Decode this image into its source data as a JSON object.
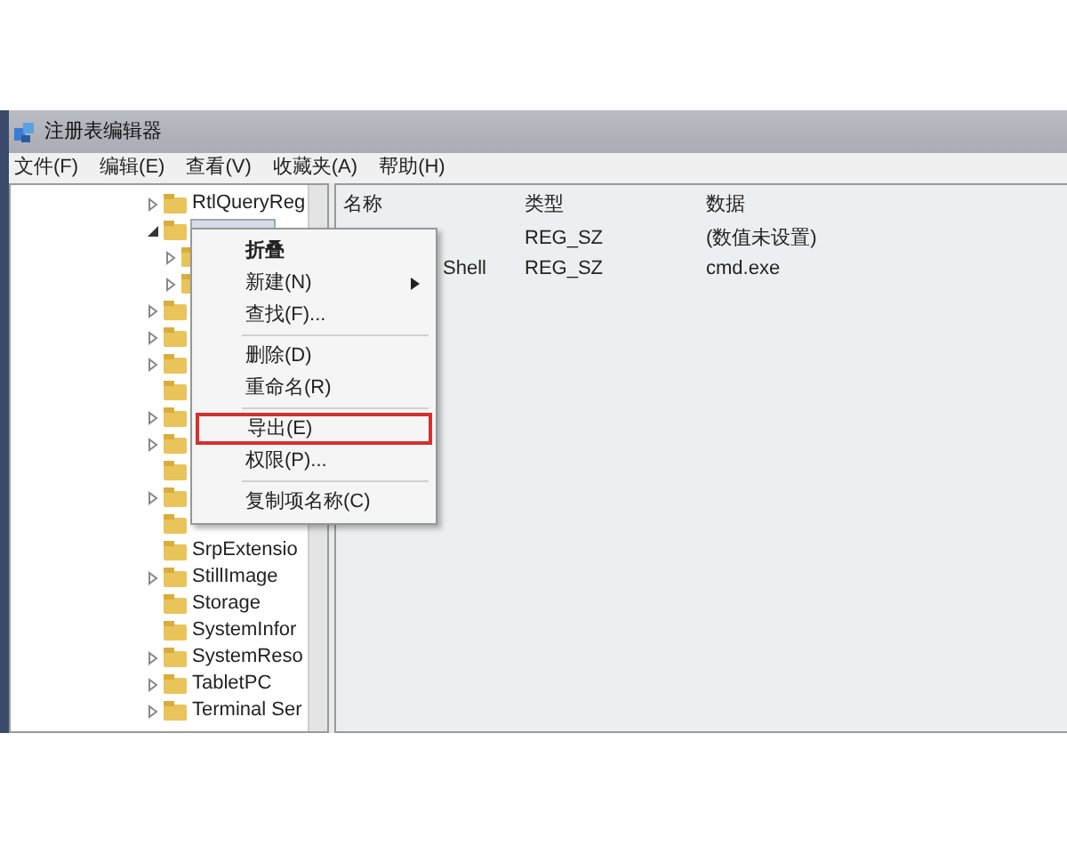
{
  "window": {
    "title": "注册表编辑器"
  },
  "menu_bar": [
    "文件(F)",
    "编辑(E)",
    "查看(V)",
    "收藏夹(A)",
    "帮助(H)"
  ],
  "tree": [
    {
      "label": "RtlQueryReg",
      "expandable": true,
      "expanded": false,
      "selected": false
    },
    {
      "expandable": true,
      "expanded": true,
      "selected": true,
      "children": [
        {
          "expandable": true
        },
        {
          "expandable": true
        }
      ]
    },
    {
      "expandable": true
    },
    {
      "expandable": true
    },
    {
      "expandable": true
    },
    {
      "expandable": false
    },
    {
      "expandable": true
    },
    {
      "expandable": true
    },
    {
      "expandable": false
    },
    {
      "expandable": true
    },
    {
      "expandable": false
    },
    {
      "label": "SrpExtensio",
      "expandable": false,
      "selected": false
    },
    {
      "label": "StillImage",
      "expandable": true,
      "expanded": false,
      "selected": false
    },
    {
      "label": "Storage",
      "expandable": false,
      "selected": false
    },
    {
      "label": "SystemInfor",
      "expandable": false,
      "selected": false
    },
    {
      "label": "SystemReso",
      "expandable": true,
      "expanded": false,
      "selected": false
    },
    {
      "label": "TabletPC",
      "expandable": true,
      "expanded": false,
      "selected": false
    },
    {
      "label": "Terminal Ser",
      "expandable": true,
      "expanded": false,
      "selected": false
    }
  ],
  "list": {
    "columns": [
      "名称",
      "类型",
      "数据"
    ],
    "rows": [
      {
        "name": "",
        "type": "REG_SZ",
        "data": "(数值未设置)"
      },
      {
        "name": "Shell",
        "type": "REG_SZ",
        "data": "cmd.exe"
      }
    ]
  },
  "context_menu": [
    {
      "kind": "item",
      "label": "折叠",
      "bold": true,
      "submenu": false,
      "highlighted": false
    },
    {
      "kind": "item",
      "label": "新建(N)",
      "bold": false,
      "submenu": true,
      "highlighted": false
    },
    {
      "kind": "item",
      "label": "查找(F)...",
      "bold": false,
      "submenu": false,
      "highlighted": false
    },
    {
      "kind": "separator"
    },
    {
      "kind": "item",
      "label": "删除(D)",
      "bold": false,
      "submenu": false,
      "highlighted": false
    },
    {
      "kind": "item",
      "label": "重命名(R)",
      "bold": false,
      "submenu": false,
      "highlighted": false
    },
    {
      "kind": "separator"
    },
    {
      "kind": "item",
      "label": "导出(E)",
      "bold": false,
      "submenu": false,
      "highlighted": true
    },
    {
      "kind": "item",
      "label": "权限(P)...",
      "bold": false,
      "submenu": false,
      "highlighted": false
    },
    {
      "kind": "separator"
    },
    {
      "kind": "item",
      "label": "复制项名称(C)",
      "bold": false,
      "submenu": false,
      "highlighted": false
    }
  ]
}
